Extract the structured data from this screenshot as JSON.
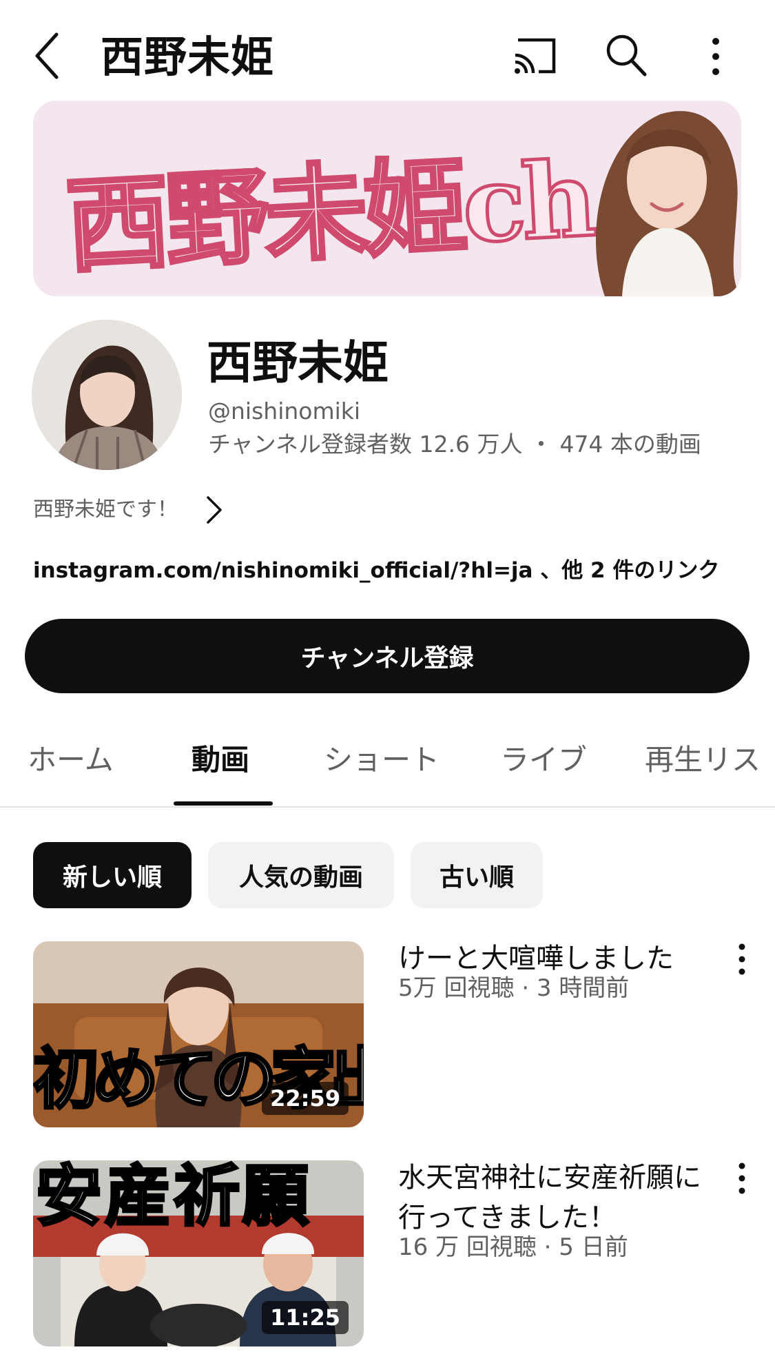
{
  "topbar": {
    "title": "西野未姫",
    "icons": [
      "back-icon",
      "cast-icon",
      "search-icon",
      "more-vert-icon"
    ]
  },
  "banner": {
    "text": "西野未姫ch"
  },
  "channel": {
    "name": "西野未姫",
    "handle": "@nishinomiki",
    "stats": "チャンネル登録者数 12.6 万人 ・ 474 本の動画",
    "description": "西野未姫です！",
    "links": "instagram.com/nishinomiki_official/?hl=ja 、他 2 件のリンク",
    "subscribe_label": "チャンネル登録"
  },
  "tabs": [
    {
      "label": "ホーム",
      "active": false
    },
    {
      "label": "動画",
      "active": true
    },
    {
      "label": "ショート",
      "active": false
    },
    {
      "label": "ライブ",
      "active": false
    },
    {
      "label": "再生リス",
      "active": false
    }
  ],
  "chips": [
    {
      "label": "新しい順",
      "active": true
    },
    {
      "label": "人気の動画",
      "active": false
    },
    {
      "label": "古い順",
      "active": false
    }
  ],
  "videos": [
    {
      "title": "けーと大喧嘩しました",
      "meta": "5万 回視聴 · 3 時間前",
      "duration": "22:59",
      "thumb_text": "初めての家出"
    },
    {
      "title": "水天宮神社に安産祈願に行ってきました！",
      "meta": "16 万 回視聴 · 5 日前",
      "duration": "11:25",
      "thumb_text": "安産祈願"
    }
  ],
  "colors": {
    "accent": "#0f0f0f",
    "secondary_text": "#606060",
    "chip_bg": "#f2f2f2",
    "banner_bg": "#f3e6ef",
    "banner_text_stroke": "#cf4a6c"
  }
}
